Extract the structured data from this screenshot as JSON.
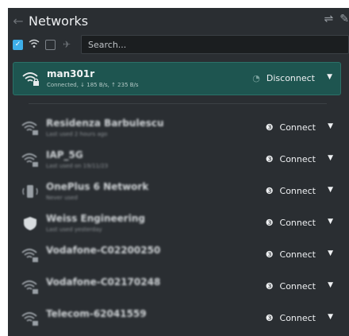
{
  "window": {
    "title": "Networks"
  },
  "toolbar": {
    "search_placeholder": "Search..."
  },
  "active": {
    "name": "man301r",
    "detail": "Connected, ↓ 185 B/s, ↑ 235 B/s",
    "action": "Disconnect"
  },
  "networks": [
    {
      "name": "Residenza Barbulescu",
      "detail": "Last used 2 hours ago",
      "action": "Connect",
      "icon": "wifi-locked-icon"
    },
    {
      "name": "IAP_5G",
      "detail": "Last used on 19/11/23",
      "action": "Connect",
      "icon": "wifi-locked-icon"
    },
    {
      "name": "OnePlus 6 Network",
      "detail": "Never used",
      "action": "Connect",
      "icon": "phone-hotspot-icon"
    },
    {
      "name": "Weiss Engineering",
      "detail": "Last used yesterday",
      "action": "Connect",
      "icon": "shield-icon"
    },
    {
      "name": "Vodafone-C02200250",
      "detail": "",
      "action": "Connect",
      "icon": "wifi-locked-icon"
    },
    {
      "name": "Vodafone-C02170248",
      "detail": "",
      "action": "Connect",
      "icon": "wifi-locked-icon"
    },
    {
      "name": "Telecom-62041559",
      "detail": "",
      "action": "Connect",
      "icon": "wifi-locked-icon"
    }
  ],
  "colors": {
    "active_bg": "#1e5550",
    "panel_bg": "#2a2e32",
    "accent": "#3daee9"
  }
}
